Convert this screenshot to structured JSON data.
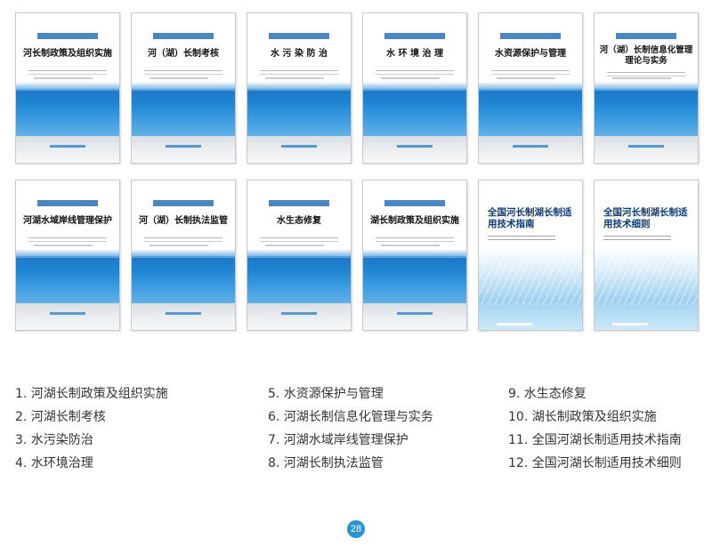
{
  "covers": [
    {
      "title": "河长制政策及组织实施",
      "style": "sea"
    },
    {
      "title": "河（湖）长制考核",
      "style": "sea"
    },
    {
      "title": "水 污 染 防 治",
      "style": "sea"
    },
    {
      "title": "水 环 境 治 理",
      "style": "sea"
    },
    {
      "title": "水资源保护与管理",
      "style": "sea"
    },
    {
      "title": "河（湖）长制信息化管理理论与实务",
      "style": "sea"
    },
    {
      "title": "河湖水域岸线管理保护",
      "style": "sea"
    },
    {
      "title": "河（湖）长制执法监管",
      "style": "sea"
    },
    {
      "title": "水生态修复",
      "style": "sea"
    },
    {
      "title": "湖长制政策及组织实施",
      "style": "sea"
    },
    {
      "title": "全国河长制湖长制适用技术指南",
      "style": "tech"
    },
    {
      "title": "全国河长制湖长制适用技术细则",
      "style": "tech"
    }
  ],
  "list_columns": [
    [
      "1. 河湖长制政策及组织实施",
      "2. 河湖长制考核",
      "3. 水污染防治",
      "4. 水环境治理"
    ],
    [
      "5. 水资源保护与管理",
      "6. 河湖长制信息化管理与实务",
      "7. 河湖水域岸线管理保护",
      "8. 河湖长制执法监管"
    ],
    [
      "9. 水生态修复",
      "10. 湖长制政策及组织实施",
      "11. 全国河湖长制适用技术指南",
      "12. 全国河湖长制适用技术细则"
    ]
  ],
  "page_number": "28"
}
